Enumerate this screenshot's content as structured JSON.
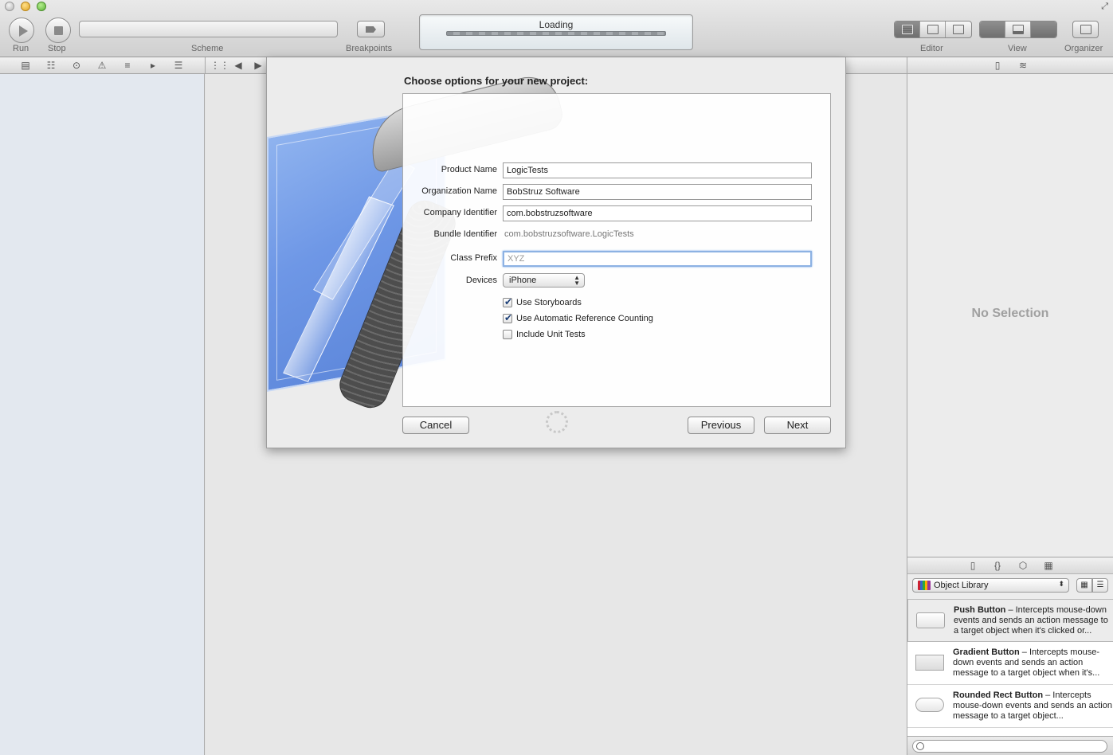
{
  "toolbar": {
    "run_label": "Run",
    "stop_label": "Stop",
    "scheme_label": "Scheme",
    "breakpoints_label": "Breakpoints",
    "activity_text": "Loading",
    "editor_label": "Editor",
    "view_label": "View",
    "organizer_label": "Organizer"
  },
  "dialog": {
    "title": "Choose options for your new project:",
    "fields": {
      "product_name": {
        "label": "Product Name",
        "value": "LogicTests"
      },
      "organization_name": {
        "label": "Organization Name",
        "value": "BobStruz Software"
      },
      "company_identifier": {
        "label": "Company Identifier",
        "value": "com.bobstruzsoftware"
      },
      "bundle_identifier": {
        "label": "Bundle Identifier",
        "value": "com.bobstruzsoftware.LogicTests"
      },
      "class_prefix": {
        "label": "Class Prefix",
        "placeholder": "XYZ"
      },
      "devices": {
        "label": "Devices",
        "value": "iPhone"
      }
    },
    "checkboxes": {
      "use_storyboards": {
        "label": "Use Storyboards",
        "checked": true
      },
      "use_arc": {
        "label": "Use Automatic Reference Counting",
        "checked": true
      },
      "include_unit_tests": {
        "label": "Include Unit Tests",
        "checked": false
      }
    },
    "buttons": {
      "cancel": "Cancel",
      "previous": "Previous",
      "next": "Next"
    }
  },
  "inspector": {
    "no_selection": "No Selection"
  },
  "library": {
    "popup_value": "Object Library",
    "items": [
      {
        "name": "Push Button",
        "desc": " – Intercepts mouse-down events and sends an action message to a target object when it's clicked or..."
      },
      {
        "name": "Gradient Button",
        "desc": " – Intercepts mouse-down events and sends an action message to a target object when it's..."
      },
      {
        "name": "Rounded Rect Button",
        "desc": " – Intercepts mouse-down events and sends an action message to a target object..."
      }
    ]
  },
  "colors": {
    "accent_focus": "#8db2e3",
    "check_color": "#1c3f77",
    "navigator_bg": "#e3e8ef"
  }
}
